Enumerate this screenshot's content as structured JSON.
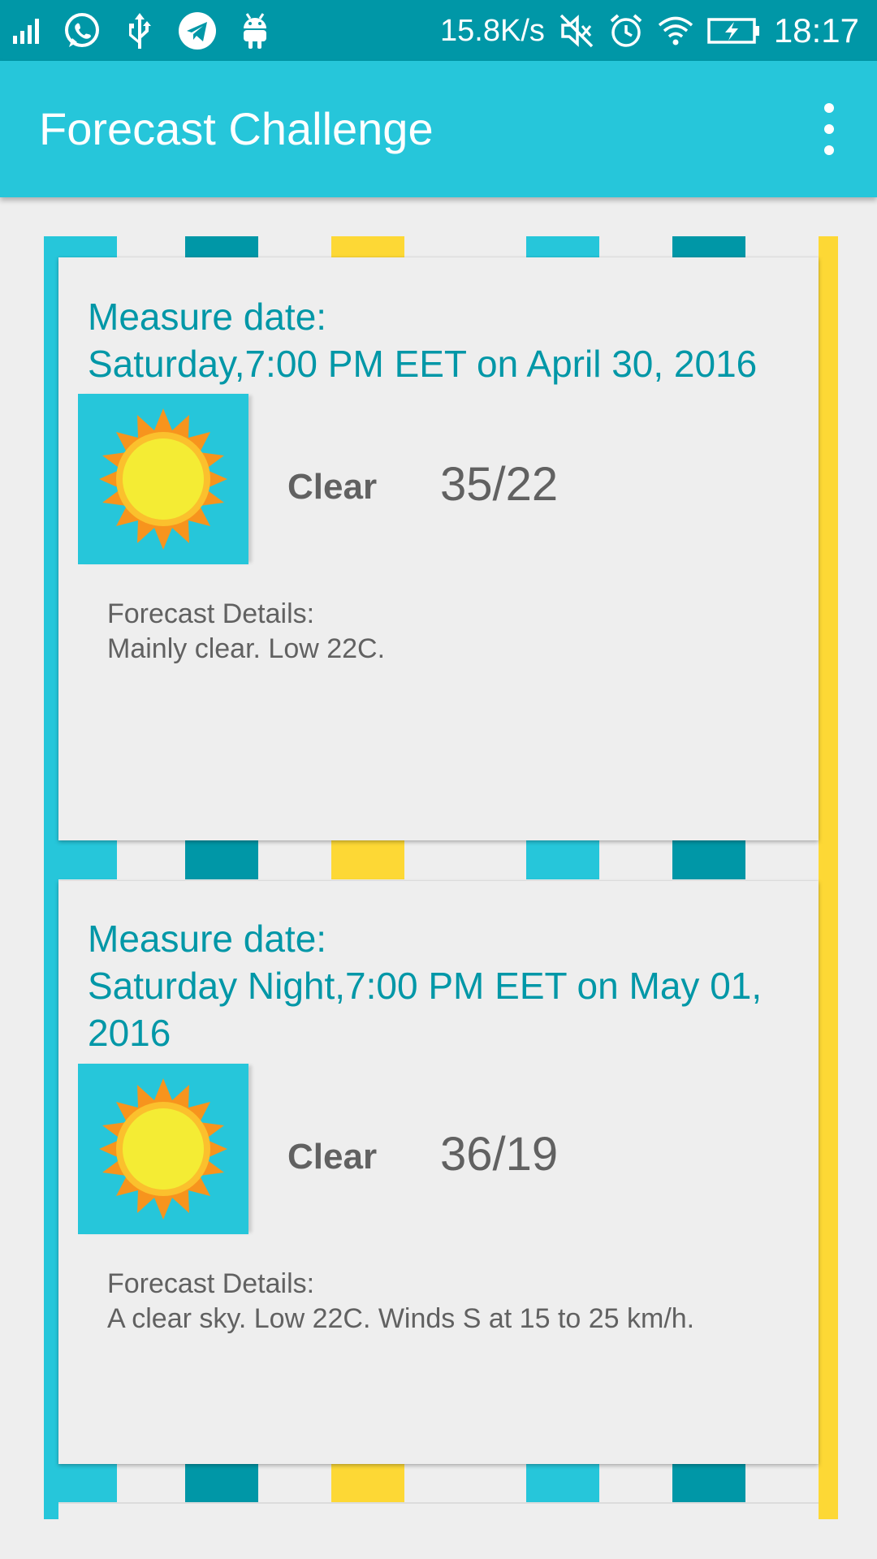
{
  "status_bar": {
    "net_speed": "15.8K/s",
    "time": "18:17",
    "left_icons": [
      "signal-icon",
      "whatsapp-icon",
      "usb-icon",
      "telegram-icon",
      "android-icon"
    ],
    "right_icons": [
      "mute-icon",
      "alarm-icon",
      "wifi-icon",
      "battery-charging-icon"
    ]
  },
  "app_bar": {
    "title": "Forecast Challenge",
    "menu_icon": "more-vert-icon"
  },
  "colors": {
    "status_bar": "#0097a7",
    "app_bar": "#26c6da",
    "accent_teal": "#0097a7",
    "accent_cyan": "#26c6da",
    "accent_yellow": "#fdd835",
    "text_gray": "#616161"
  },
  "forecasts": [
    {
      "measure_label": "Measure date:",
      "measure_value": "Saturday,7:00 PM EET on April 30, 2016",
      "icon": "sun-icon",
      "condition": "Clear",
      "temps": "35/22",
      "details_label": "Forecast Details:",
      "details_text": "Mainly clear. Low 22C."
    },
    {
      "measure_label": "Measure date:",
      "measure_value": "Saturday Night,7:00 PM EET on May 01, 2016",
      "icon": "sun-icon",
      "condition": "Clear",
      "temps": "36/19",
      "details_label": "Forecast Details:",
      "details_text": "A clear sky. Low 22C. Winds S at 15 to 25 km/h."
    }
  ]
}
